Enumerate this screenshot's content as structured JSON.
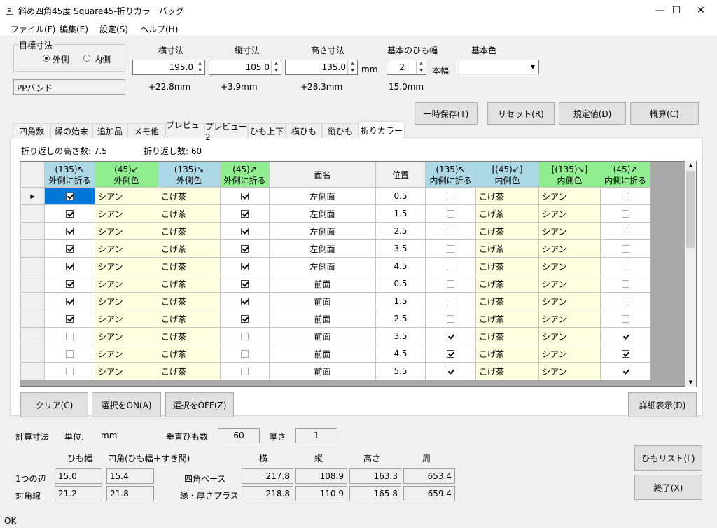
{
  "window": {
    "title": "斜め四角45度 Square45-折りカラーバッグ",
    "minimize": "—",
    "maximize": "☐",
    "close": "✕"
  },
  "menu": [
    "ファイル(F)",
    "編集(E)",
    "設定(S)",
    "ヘルプ(H)"
  ],
  "target_size": {
    "label": "目標寸法",
    "outer": "外側",
    "inner": "内側",
    "selected": "outer"
  },
  "dims": {
    "width_label": "横寸法",
    "width_value": "195.0",
    "width_delta": "+22.8mm",
    "depth_label": "縦寸法",
    "depth_value": "105.0",
    "depth_delta": "+3.9mm",
    "height_label": "高さ寸法",
    "height_value": "135.0",
    "height_delta": "+28.3mm",
    "unit": "mm",
    "band_width_label": "基本のひも幅",
    "band_width_value": "2",
    "band_unit": "本幅",
    "band_mm": "15.0mm",
    "base_color_label": "基本色",
    "base_color_value": ""
  },
  "material": "PPバンド",
  "buttons": {
    "temp_save": "一時保存(T)",
    "reset": "リセット(R)",
    "defaults": "規定値(D)",
    "estimate": "概算(C)",
    "clear": "クリア(C)",
    "select_on": "選択をON(A)",
    "select_off": "選択をOFF(Z)",
    "details": "詳細表示(D)",
    "band_list": "ひもリスト(L)",
    "exit": "終了(X)"
  },
  "tabs": [
    "四角数",
    "縁の始末",
    "追加品",
    "メモ他",
    "プレビュー",
    "プレビュー2",
    "ひも上下",
    "横ひも",
    "縦ひも",
    "折りカラー"
  ],
  "active_tab": 9,
  "fold_info": {
    "height_count": "折り返しの高さ数: 7.5",
    "fold_count": "折り返し数: 60"
  },
  "grid": {
    "headers": [
      [
        "(135)↖",
        "外側に折る"
      ],
      [
        "(45)↙",
        "外側色"
      ],
      [
        "(135)↘",
        "外側色"
      ],
      [
        "(45)↗",
        "外側に折る"
      ],
      [
        "",
        "面名"
      ],
      [
        "",
        "位置"
      ],
      [
        "(135)↖",
        "内側に折る"
      ],
      [
        "[(45)↙]",
        "内側色"
      ],
      [
        "[(135)↘]",
        "内側色"
      ],
      [
        "(45)↗",
        "内側に折る"
      ]
    ],
    "rows": [
      [
        true,
        "シアン",
        "こげ茶",
        true,
        "左側面",
        "0.5",
        false,
        "こげ茶",
        "シアン",
        false
      ],
      [
        true,
        "シアン",
        "こげ茶",
        true,
        "左側面",
        "1.5",
        false,
        "こげ茶",
        "シアン",
        false
      ],
      [
        true,
        "シアン",
        "こげ茶",
        true,
        "左側面",
        "2.5",
        false,
        "こげ茶",
        "シアン",
        false
      ],
      [
        true,
        "シアン",
        "こげ茶",
        true,
        "左側面",
        "3.5",
        false,
        "こげ茶",
        "シアン",
        false
      ],
      [
        true,
        "シアン",
        "こげ茶",
        true,
        "左側面",
        "4.5",
        false,
        "こげ茶",
        "シアン",
        false
      ],
      [
        true,
        "シアン",
        "こげ茶",
        true,
        "前面",
        "0.5",
        false,
        "こげ茶",
        "シアン",
        false
      ],
      [
        true,
        "シアン",
        "こげ茶",
        true,
        "前面",
        "1.5",
        false,
        "こげ茶",
        "シアン",
        false
      ],
      [
        true,
        "シアン",
        "こげ茶",
        true,
        "前面",
        "2.5",
        false,
        "こげ茶",
        "シアン",
        false
      ],
      [
        false,
        "シアン",
        "こげ茶",
        false,
        "前面",
        "3.5",
        true,
        "こげ茶",
        "シアン",
        true
      ],
      [
        false,
        "シアン",
        "こげ茶",
        false,
        "前面",
        "4.5",
        true,
        "こげ茶",
        "シアン",
        true
      ],
      [
        false,
        "シアン",
        "こげ茶",
        false,
        "前面",
        "5.5",
        true,
        "こげ茶",
        "シアン",
        true
      ]
    ]
  },
  "calc": {
    "label": "計算寸法",
    "unit_label": "単位:",
    "unit": "mm",
    "vband_label": "垂直ひも数",
    "vband_value": "60",
    "thickness_label": "厚さ",
    "thickness_value": "1",
    "col_band": "ひも幅",
    "col_square": "四角(ひも幅＋すき間)",
    "col_w": "横",
    "col_d": "縦",
    "col_h": "高さ",
    "col_p": "周",
    "row1_label": "1つの辺",
    "row1_band": "15.0",
    "row1_square": "15.4",
    "row2_label": "対角線",
    "row2_band": "21.2",
    "row2_square": "21.8",
    "base_label": "四角ベース",
    "base": [
      "217.8",
      "108.9",
      "163.3",
      "653.4"
    ],
    "edge_label": "縁・厚さプラス",
    "edge": [
      "218.8",
      "110.9",
      "165.8",
      "659.4"
    ]
  },
  "status": "OK"
}
